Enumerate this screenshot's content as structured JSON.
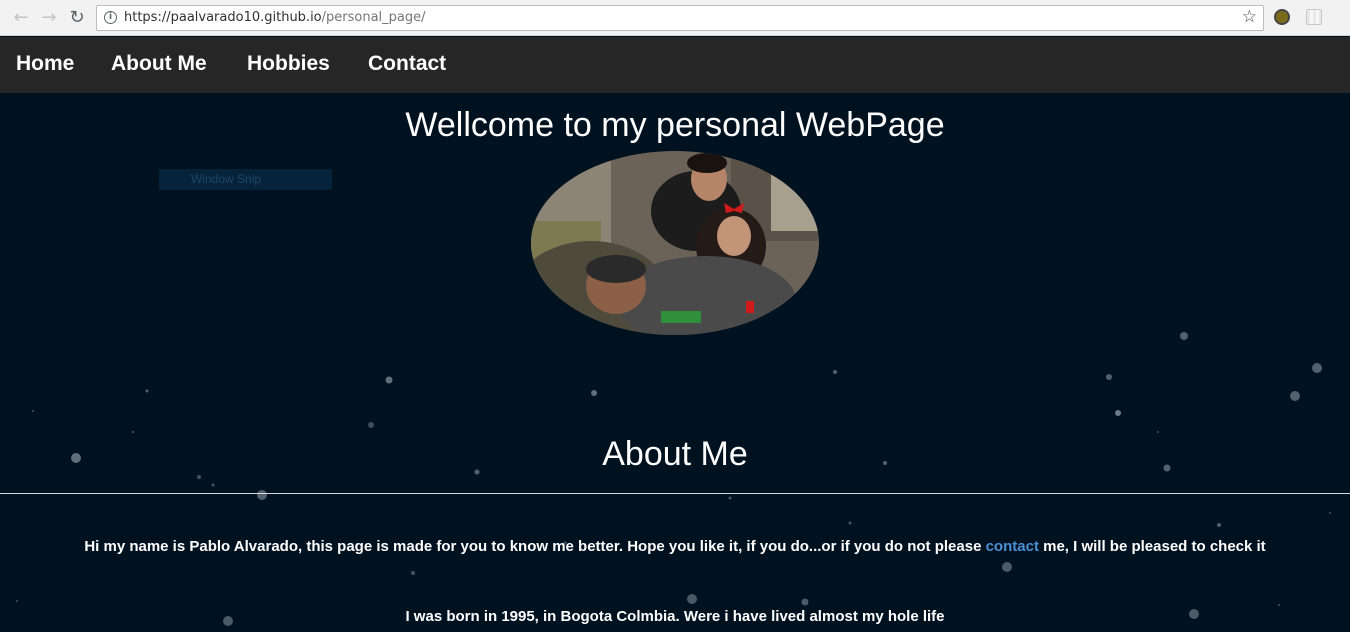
{
  "browser": {
    "back_icon": "back-arrow-icon",
    "forward_icon": "forward-arrow-icon",
    "reload_icon": "reload-icon",
    "url_host": "https://paalvarado10.github.io",
    "url_path": "/personal_page/"
  },
  "nav": {
    "items": [
      {
        "label": "Home"
      },
      {
        "label": "About Me"
      },
      {
        "label": "Hobbies"
      },
      {
        "label": "Contact"
      }
    ]
  },
  "header": {
    "title": "Wellcome to my personal WebPage",
    "window_snip": "Window Snip"
  },
  "about": {
    "title": "About Me",
    "intro_before": "Hi my name is Pablo Alvarado, this page is made for you to know me better. Hope you like it, if you do...or if you do not please ",
    "intro_link": "contact",
    "intro_after": " me, I will be pleased to check it",
    "born": "I was born in 1995, in Bogota Colmbia. Were i have lived almost my hole life"
  },
  "colors": {
    "background": "#00111f",
    "nav_background": "#262626",
    "link": "#4d8fd6"
  }
}
